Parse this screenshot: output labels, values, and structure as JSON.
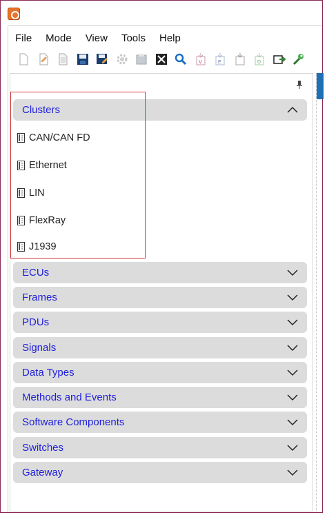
{
  "menu": {
    "items": [
      "File",
      "Mode",
      "View",
      "Tools",
      "Help"
    ]
  },
  "toolbar": {
    "icons": [
      "new-file-icon",
      "edit-file-icon",
      "document-icon",
      "save-icon",
      "save-as-icon",
      "settings-gear-icon",
      "generate-icon",
      "close-x-icon",
      "search-icon",
      "export-v-icon",
      "export-e-icon",
      "export-icon",
      "export-d-icon",
      "export-run-icon",
      "wrench-icon"
    ]
  },
  "sections": [
    {
      "label": "Clusters",
      "expanded": true
    },
    {
      "label": "ECUs",
      "expanded": false
    },
    {
      "label": "Frames",
      "expanded": false
    },
    {
      "label": "PDUs",
      "expanded": false
    },
    {
      "label": "Signals",
      "expanded": false
    },
    {
      "label": "Data Types",
      "expanded": false
    },
    {
      "label": "Methods and Events",
      "expanded": false
    },
    {
      "label": "Software Components",
      "expanded": false
    },
    {
      "label": "Switches",
      "expanded": false
    },
    {
      "label": "Gateway",
      "expanded": false
    }
  ],
  "clusters": {
    "items": [
      "CAN/CAN FD",
      "Ethernet",
      "LIN",
      "FlexRay",
      "J1939"
    ]
  },
  "colors": {
    "section_text": "#1e1edc",
    "section_bg": "#dcdcdc",
    "highlight": "#d23a3a",
    "frame": "#8a2a55"
  }
}
